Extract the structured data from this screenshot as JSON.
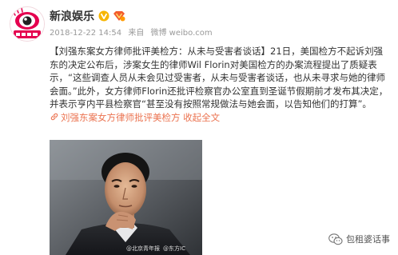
{
  "post": {
    "author": "新浪娱乐",
    "timestamp": "2018-12-22 14:54",
    "source_prefix": "来自",
    "source": "微博 weibo.com",
    "text_before_quote": "【刘强东案女方律师批评美检方：从未与受害者谈话】21日，美国检方不起诉刘强东的决定公布后，涉案女生的律师Wil Florin对美国检方的办案流程提出了质疑表示，",
    "quote_1": "“这些调查人员从未会见过受害者，从未与受害者谈话，也从未寻求与她的律师会面。”",
    "quote_2": "此外，女方律师Florin还批评检察官办公室直到圣诞节假期前才发布其决定，并表示亨内平县检察官“甚至没有按照常规做法与她会面，以告知他们的打算”。",
    "topic_link": "刘强东案女方律师批评美检方",
    "expand_link": "收起全文",
    "photo_caption": "@北京青年报",
    "photo_caption_2": "@东方IC"
  },
  "watermark": {
    "text": "包租婆话事"
  },
  "colors": {
    "link": "#eb7350",
    "text": "#333333",
    "meta": "#999999",
    "verified": "#f7b500",
    "avatar_brand": "#e5004f"
  },
  "icons": {
    "verified": "verified-v-icon",
    "vip": "vip-icon",
    "link": "link-icon",
    "watermark": "wechat-icon"
  }
}
